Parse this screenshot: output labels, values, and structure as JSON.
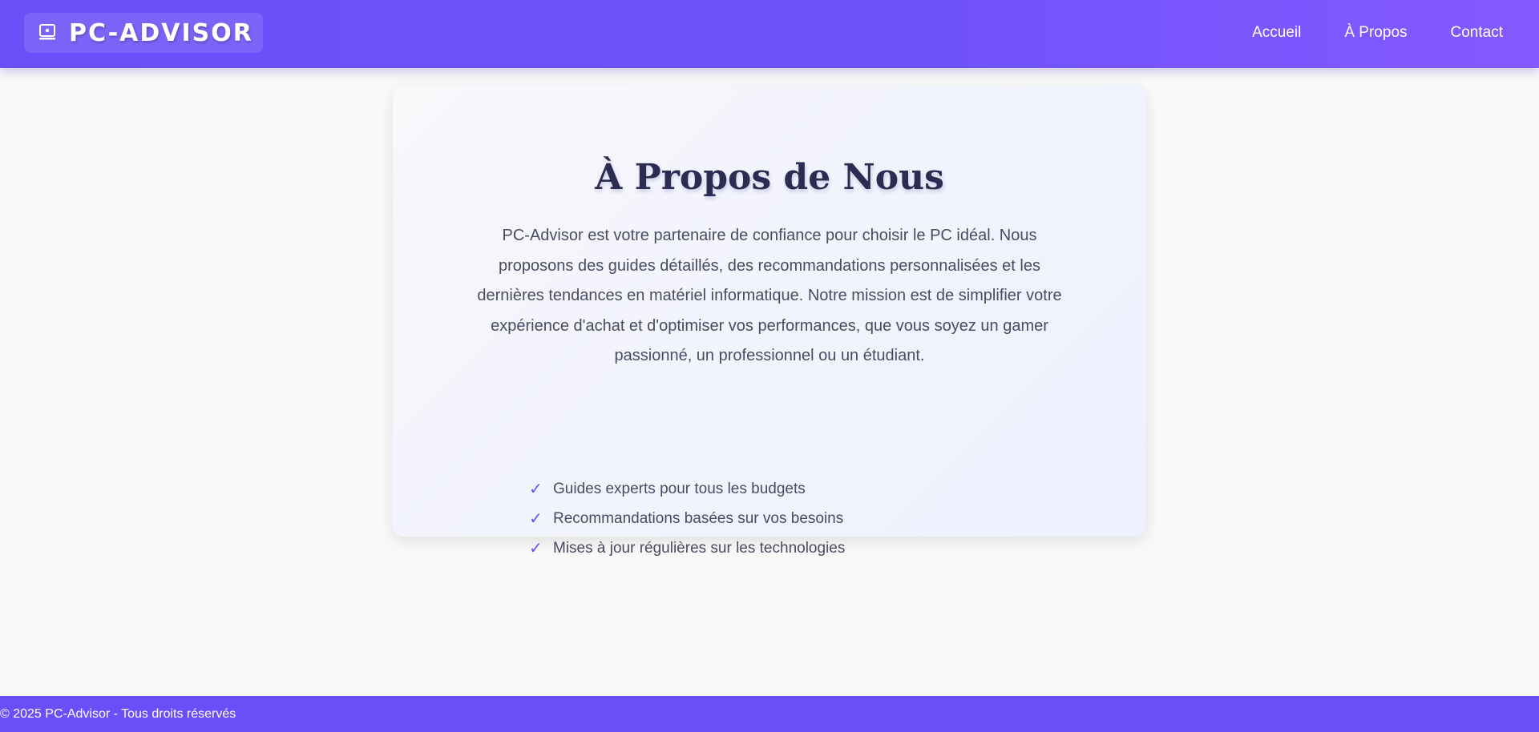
{
  "header": {
    "brand_icon": "laptop-icon",
    "brand_name": "PC-ADVISOR",
    "nav": [
      {
        "label": "Accueil"
      },
      {
        "label": "À Propos"
      },
      {
        "label": "Contact"
      }
    ]
  },
  "about": {
    "title": "À Propos de Nous",
    "description": "PC-Advisor est votre partenaire de confiance pour choisir le PC idéal. Nous proposons des guides détaillés, des recommandations personnalisées et les dernières tendances en matériel informatique. Notre mission est de simplifier votre expérience d'achat et d'optimiser vos performances, que vous soyez un gamer passionné, un professionnel ou un étudiant.",
    "check_symbol": "✓",
    "features": [
      {
        "text": "Guides experts pour tous les budgets"
      },
      {
        "text": "Recommandations basées sur vos besoins"
      },
      {
        "text": "Mises à jour régulières sur les technologies"
      }
    ]
  },
  "footer": {
    "text": "© 2025 PC-Advisor - Tous droits réservés"
  },
  "colors": {
    "primary": "#6a4ef8",
    "title": "#2d2b52",
    "text": "#4a4a62",
    "background": "#f9f9f9"
  }
}
